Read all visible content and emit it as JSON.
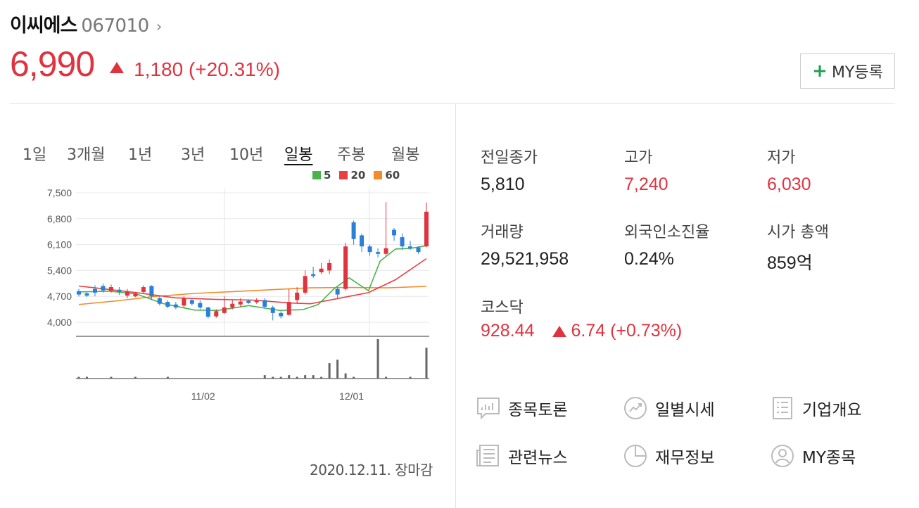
{
  "stock": {
    "name": "이씨에스",
    "code": "067010",
    "price": "6,990",
    "change": "1,180 (+20.31%)",
    "my_button": "MY등록"
  },
  "tabs": [
    "1일",
    "3개월",
    "1년",
    "3년",
    "10년",
    "일봉",
    "주봉",
    "월봉"
  ],
  "active_tab": "일봉",
  "legend": [
    {
      "label": "5",
      "color": "#4bb34b"
    },
    {
      "label": "20",
      "color": "#e84040"
    },
    {
      "label": "60",
      "color": "#f28c28"
    }
  ],
  "chart_data": {
    "type": "candlestick",
    "y_ticks": [
      "7,500",
      "6,800",
      "6,100",
      "5,400",
      "4,700",
      "4,000"
    ],
    "ylim": [
      4000,
      7500
    ],
    "x_ticks": [
      "11/02",
      "12/01"
    ],
    "up_color": "#e0323f",
    "down_color": "#2a7fd8",
    "ma_colors": {
      "ma5": "#4bb34b",
      "ma20": "#e84040",
      "ma60": "#f28c28"
    },
    "ma60": [
      [
        0,
        4480
      ],
      [
        10,
        4580
      ],
      [
        20,
        4700
      ],
      [
        30,
        4780
      ],
      [
        40,
        4830
      ],
      [
        50,
        4880
      ],
      [
        60,
        4930
      ],
      [
        70,
        4940
      ],
      [
        80,
        4930
      ],
      [
        90,
        4970
      ]
    ],
    "ma20": [
      [
        0,
        4980
      ],
      [
        15,
        4800
      ],
      [
        25,
        4660
      ],
      [
        35,
        4620
      ],
      [
        45,
        4600
      ],
      [
        55,
        4520
      ],
      [
        60,
        4500
      ],
      [
        68,
        4660
      ],
      [
        75,
        4800
      ],
      [
        82,
        5150
      ],
      [
        90,
        5720
      ]
    ],
    "ma5": [
      [
        0,
        4820
      ],
      [
        8,
        4840
      ],
      [
        15,
        4760
      ],
      [
        22,
        4500
      ],
      [
        30,
        4330
      ],
      [
        36,
        4320
      ],
      [
        44,
        4450
      ],
      [
        52,
        4320
      ],
      [
        58,
        4340
      ],
      [
        62,
        4480
      ],
      [
        66,
        4900
      ],
      [
        70,
        5200
      ],
      [
        75,
        4850
      ],
      [
        78,
        5650
      ],
      [
        82,
        5980
      ],
      [
        86,
        6000
      ],
      [
        90,
        6070
      ]
    ],
    "candles": [
      [
        4840,
        4750,
        4900,
        4700
      ],
      [
        4780,
        4720,
        4820,
        4680
      ],
      [
        4900,
        4800,
        5000,
        4700
      ],
      [
        4980,
        4860,
        5050,
        4800
      ],
      [
        4850,
        4950,
        5020,
        4800
      ],
      [
        4880,
        4820,
        4950,
        4740
      ],
      [
        4720,
        4820,
        4900,
        4650
      ],
      [
        4700,
        4780,
        4820,
        4680
      ],
      [
        4820,
        4950,
        5000,
        4780
      ],
      [
        4980,
        4700,
        5000,
        4600
      ],
      [
        4650,
        4500,
        4720,
        4450
      ],
      [
        4550,
        4420,
        4600,
        4380
      ],
      [
        4480,
        4400,
        4550,
        4350
      ],
      [
        4450,
        4650,
        4700,
        4400
      ],
      [
        4600,
        4500,
        4650,
        4450
      ],
      [
        4520,
        4400,
        4600,
        4350
      ],
      [
        4400,
        4150,
        4420,
        4100
      ],
      [
        4160,
        4300,
        4350,
        4120
      ],
      [
        4250,
        4400,
        4700,
        4220
      ],
      [
        4400,
        4500,
        4600,
        4350
      ],
      [
        4480,
        4560,
        4650,
        4420
      ],
      [
        4580,
        4520,
        4620,
        4500
      ],
      [
        4560,
        4580,
        4650,
        4500
      ],
      [
        4600,
        4420,
        4650,
        4380
      ],
      [
        4400,
        4250,
        4450,
        4050
      ],
      [
        4250,
        4160,
        4300,
        4100
      ],
      [
        4200,
        4550,
        4900,
        4180
      ],
      [
        4600,
        4800,
        4950,
        4500
      ],
      [
        4800,
        5250,
        5400,
        4750
      ],
      [
        5300,
        5250,
        5500,
        5200
      ],
      [
        5350,
        5450,
        5600,
        5300
      ],
      [
        5400,
        5600,
        5700,
        5300
      ],
      [
        4900,
        4750,
        4950,
        4650
      ],
      [
        4900,
        6050,
        6150,
        4850
      ],
      [
        6700,
        6250,
        6750,
        6100
      ],
      [
        6350,
        6050,
        6400,
        5900
      ],
      [
        6050,
        5900,
        6100,
        5800
      ],
      [
        5900,
        5850,
        6000,
        5750
      ],
      [
        5850,
        6000,
        7250,
        5800
      ],
      [
        6500,
        6350,
        6550,
        6200
      ],
      [
        6300,
        6050,
        6400,
        5950
      ],
      [
        6050,
        6000,
        6200,
        5950
      ],
      [
        6020,
        5900,
        6050,
        5850
      ],
      [
        6050,
        6990,
        7240,
        6030
      ]
    ],
    "volume": [
      1,
      1,
      0,
      0,
      1,
      0,
      0,
      1,
      0,
      0,
      0,
      1,
      0,
      0,
      0,
      0,
      0,
      0,
      0,
      0,
      0,
      0,
      0,
      2,
      1,
      1,
      2,
      1,
      2,
      2,
      1,
      9,
      11,
      3,
      1,
      0,
      0,
      23,
      1,
      0,
      0,
      1,
      0,
      18
    ]
  },
  "stats": {
    "prev_close": {
      "label": "전일종가",
      "value": "5,810"
    },
    "high": {
      "label": "고가",
      "value": "7,240"
    },
    "low": {
      "label": "저가",
      "value": "6,030"
    },
    "volume": {
      "label": "거래량",
      "value": "29,521,958"
    },
    "foreign": {
      "label": "외국인소진율",
      "value": "0.24%"
    },
    "market_cap": {
      "label": "시가 총액",
      "value": "859억"
    },
    "kosdaq": {
      "label": "코스닥",
      "value": "928.44",
      "change": "6.74 (+0.73%)"
    }
  },
  "date": "2020.12.11. 장마감",
  "links": {
    "discussion": "종목토론",
    "daily": "일별시세",
    "company": "기업개요",
    "news": "관련뉴스",
    "finance": "재무정보",
    "my": "MY종목"
  }
}
